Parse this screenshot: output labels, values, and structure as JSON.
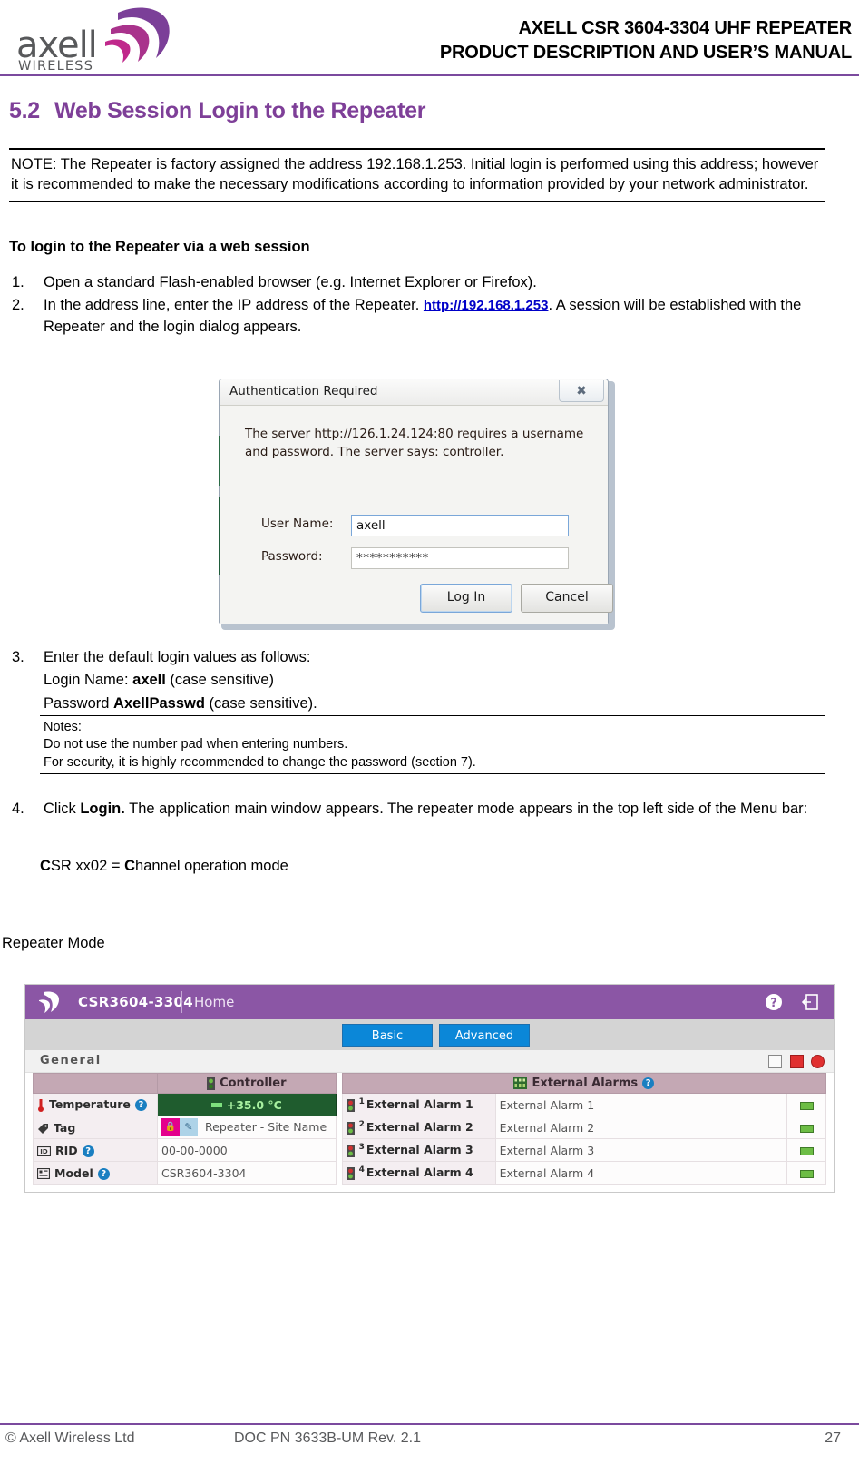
{
  "header": {
    "logo_word": "axell",
    "logo_sub": "WIRELESS",
    "title_line1": "AXELL CSR 3604-3304 UHF REPEATER",
    "title_line2": "PRODUCT DESCRIPTION AND USER’S MANUAL",
    "rule_color": "#7b4a9e"
  },
  "section": {
    "number": "5.2",
    "title": "Web Session Login to the Repeater",
    "color": "#7e3f98"
  },
  "note": {
    "text": "NOTE: The Repeater is factory assigned the address 192.168.1.253. Initial login is performed using this address; however it is recommended to make the necessary modifications according to information provided by your network administrator."
  },
  "procedure": {
    "lead": "To login to the Repeater via a web session",
    "steps": [
      {
        "marker": "1.",
        "text": "Open a standard Flash-enabled browser (e.g. Internet Explorer or Firefox)."
      },
      {
        "marker": "2.",
        "pre": "In the address line, enter the IP address of the Repeater. ",
        "link": "http://192.168.1.253",
        "post": ". A session will be established with the Repeater and the login dialog appears."
      }
    ],
    "step3": {
      "marker": "3.",
      "text": "Enter the default login values as follows:",
      "login_label": "Login Name: ",
      "login_value": "axell",
      "login_suffix": " (case sensitive)",
      "pw_label": "Password ",
      "pw_value": "AxellPasswd",
      "pw_suffix": " (case sensitive)."
    },
    "notes_box": {
      "title": "Notes:",
      "line1": "Do not use the number pad when entering numbers.",
      "line2": "For security, it is highly recommended to change the password (section 7)."
    },
    "step4": {
      "marker": "4.",
      "pre": "Click ",
      "bold": "Login.",
      "post": " The application main window appears. The repeater mode appears in the top left side of the Menu bar:"
    },
    "mode_line": {
      "b1": "C",
      "t1": "SR xx02 = ",
      "b2": "C",
      "t2": "hannel operation mode"
    },
    "repeater_mode_caption": "Repeater Mode"
  },
  "auth_dialog": {
    "title": "Authentication Required",
    "close_icon": "close-icon",
    "message": "The server http://126.1.24.124:80 requires a username and password. The server says: controller.",
    "username_label": "User Name:",
    "username_value": "axell",
    "password_label": "Password:",
    "password_value": "***********",
    "login_button": "Log In",
    "cancel_button": "Cancel"
  },
  "app": {
    "topbar": {
      "model": "CSR3604-3304",
      "page": "Home",
      "help_icon": "help-icon",
      "logout_icon": "logout-icon",
      "bg_color": "#8b56a5"
    },
    "tabs": [
      {
        "label": "Basic",
        "active": true
      },
      {
        "label": "Advanced",
        "active": false
      }
    ],
    "general": {
      "label": "General",
      "icons": [
        "door-icon",
        "minus-icon",
        "close-circle-icon"
      ]
    },
    "left_table": {
      "header_blank": "",
      "header": "Controller",
      "header_icon": "led-icon",
      "rows": [
        {
          "icon": "thermometer-icon",
          "label": "Temperature",
          "help": true,
          "value": "+35.0 °C",
          "value_style": "temp"
        },
        {
          "icon": "tag-icon",
          "label": "Tag",
          "help": false,
          "value": "Repeater - Site Name",
          "value_style": "tag"
        },
        {
          "icon": "id-icon",
          "label": "RID",
          "help": true,
          "value": "00-00-0000",
          "value_style": "plain"
        },
        {
          "icon": "model-icon",
          "label": "Model",
          "help": true,
          "value": "CSR3604-3304",
          "value_style": "plain"
        }
      ]
    },
    "right_table": {
      "header": "External Alarms",
      "header_icon": "connector-icon",
      "help": true,
      "rows": [
        {
          "index": "1",
          "label": "External Alarm 1",
          "value": "External Alarm 1",
          "led": "green"
        },
        {
          "index": "2",
          "label": "External Alarm 2",
          "value": "External Alarm 2",
          "led": "green"
        },
        {
          "index": "3",
          "label": "External Alarm 3",
          "value": "External Alarm 3",
          "led": "green"
        },
        {
          "index": "4",
          "label": "External Alarm 4",
          "value": "External Alarm 4",
          "led": "green"
        }
      ]
    }
  },
  "footer": {
    "left": "© Axell Wireless Ltd",
    "middle": "DOC PN 3633B-UM Rev. 2.1",
    "right": "27"
  }
}
